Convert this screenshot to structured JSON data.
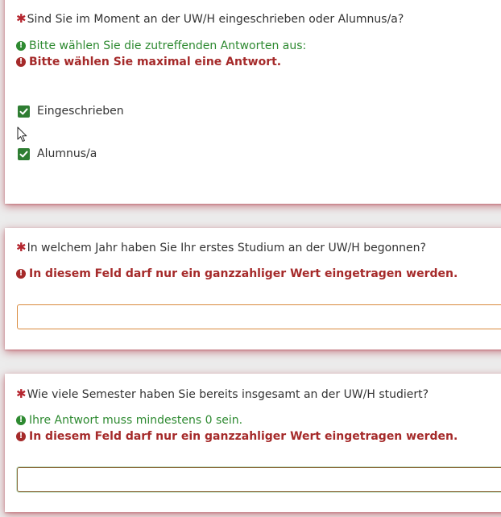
{
  "question1": {
    "text": "Sind Sie im Moment an der UW/H eingeschrieben oder Alumnus/a?",
    "hint_ok": "Bitte wählen Sie die zutreffenden Antworten aus:",
    "hint_err": "Bitte wählen Sie maximal eine Antwort.",
    "options": [
      {
        "label": "Eingeschrieben",
        "checked": true
      },
      {
        "label": "Alumnus/a",
        "checked": true
      }
    ]
  },
  "question2": {
    "text": "In welchem Jahr haben Sie Ihr erstes Studium an der UW/H begonnen?",
    "hint_err": "In diesem Feld darf nur ein ganzzahliger Wert eingetragen werden.",
    "value": ""
  },
  "question3": {
    "text": "Wie viele Semester haben Sie bereits insgesamt an der UW/H studiert?",
    "hint_ok": "Ihre Antwort muss mindestens 0 sein.",
    "hint_err": "In diesem Feld darf nur ein ganzzahliger Wert eingetragen werden.",
    "value": ""
  },
  "icons": {
    "required": "asterisk-icon",
    "info": "exclamation-circle-icon",
    "checkbox": "checkmark-icon",
    "cursor": "mouse-pointer-icon"
  },
  "colors": {
    "required": "#b5262f",
    "ok": "#2e8a31",
    "error": "#a52a2a",
    "checkbox": "#2e7d32",
    "card_shadow": "#a82834"
  }
}
